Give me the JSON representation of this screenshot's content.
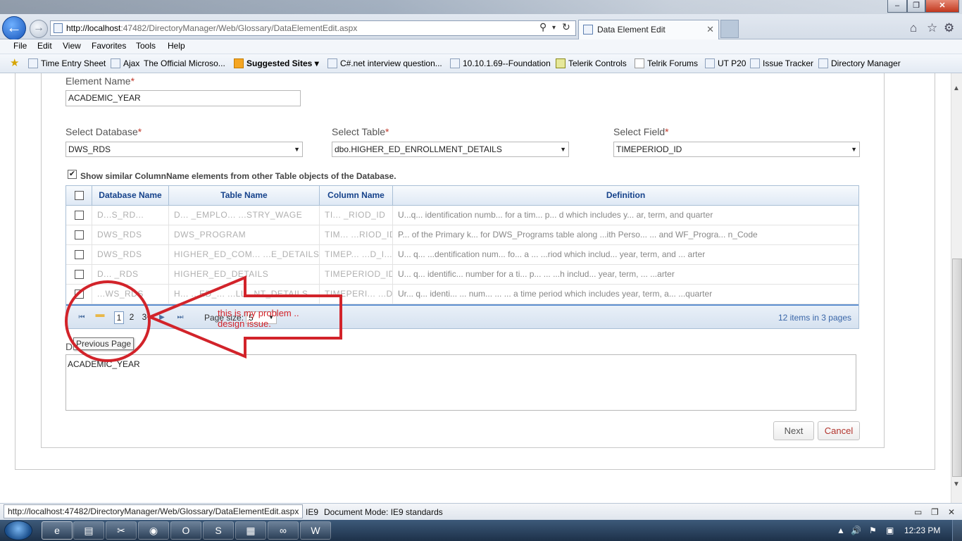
{
  "browser": {
    "address_host": "http://localhost",
    "address_rest": ":47482/DirectoryManager/Web/Glossary/DataElementEdit.aspx",
    "tab_title": "Data Element Edit",
    "menu": [
      "File",
      "Edit",
      "View",
      "Favorites",
      "Tools",
      "Help"
    ],
    "favorites": [
      {
        "label": "Time Entry Sheet",
        "bold": false
      },
      {
        "label": "Ajax",
        "bold": false
      },
      {
        "label": "The Official Microso...",
        "bold": false
      },
      {
        "label": "Suggested Sites ▾",
        "bold": true
      },
      {
        "label": "C#.net interview question...",
        "bold": false
      },
      {
        "label": "10.10.1.69--Foundation",
        "bold": false
      },
      {
        "label": "Telerik Controls",
        "bold": false
      },
      {
        "label": "Telrik Forums",
        "bold": false
      },
      {
        "label": "UT P20",
        "bold": false
      },
      {
        "label": "Issue Tracker",
        "bold": false
      },
      {
        "label": "Directory Manager",
        "bold": false
      }
    ]
  },
  "form": {
    "element_name_label": "Element Name",
    "element_name_value": "ACADEMIC_YEAR",
    "select_database_label": "Select Database",
    "select_database_value": "DWS_RDS",
    "select_table_label": "Select Table",
    "select_table_value": "dbo.HIGHER_ED_ENROLLMENT_DETAILS",
    "select_field_label": "Select Field",
    "select_field_value": "TIMEPERIOD_ID",
    "required_mark": "*",
    "similar_checkbox_label": "Show similar ColumnName elements from other Table objects of the Database.",
    "similar_checked": true,
    "description_label_visible": "D",
    "description_value": "ACADEMIC_YEAR"
  },
  "grid": {
    "headers": [
      "Database Name",
      "Table Name",
      "Column Name",
      "Definition"
    ],
    "rows": [
      {
        "db": "D...S_RD...",
        "table": "D... _EMPLO...  ...STRY_WAGE",
        "column": "TI... _RIOD_ID",
        "definition": "U...q... identification numb... for a tim... p... d which includes y... ar, term, and quarter"
      },
      {
        "db": "DWS_RDS",
        "table": "DWS_PROGRAM",
        "column": "TIM... ...RIOD_ID",
        "definition": "P... of the Primary k... for DWS_Programs table along ...ith Perso... ... and WF_Progra... n_Code"
      },
      {
        "db": "DWS_RDS",
        "table": "HIGHER_ED_COM... ...E_DETAILS",
        "column": "TIMEP... ...D_I...",
        "definition": "U... q... ...dentification num... fo... a ... ...riod which includ... year, term, and ... arter"
      },
      {
        "db": "D... _RDS",
        "table": "HIGHER_ED_DETAILS",
        "column": "TIMEPERIOD_ID",
        "definition": "U... q... identific... number for a ti... p... ... ...h includ... year, term, ... ...arter"
      },
      {
        "db": "...WS_RDS",
        "table": "H... ...ED_... ...LL...NT_DETAILS",
        "column": "TIMEPERI... ...D_ID",
        "definition": "Ur... q... identi... ... num... ... ... a time period which includes year, term, a... ...quarter"
      }
    ],
    "pager": {
      "pages": [
        "1",
        "2",
        "3"
      ],
      "current_page": "1",
      "page_size_label": "Page size:",
      "page_size_value": "5",
      "info": "12 items in 3 pages",
      "tooltip": "Previous Page"
    }
  },
  "buttons": {
    "next": "Next",
    "cancel": "Cancel"
  },
  "annotation": {
    "line1": "this is my problem ..",
    "line2": "design issue.",
    "color": "#d2232a"
  },
  "statusbar": {
    "url": "http://localhost:47482/DirectoryManager/Web/Glossary/DataElementEdit.aspx",
    "ie_mode": "IE9",
    "doc_mode": "Document Mode:  IE9 standards"
  },
  "taskbar": {
    "clock": "12:23 PM"
  },
  "colors": {
    "grid_header_text": "#15428b",
    "pager_border": "#5d8fd0",
    "required": "#c0392b",
    "cancel_text": "#b2332c"
  }
}
